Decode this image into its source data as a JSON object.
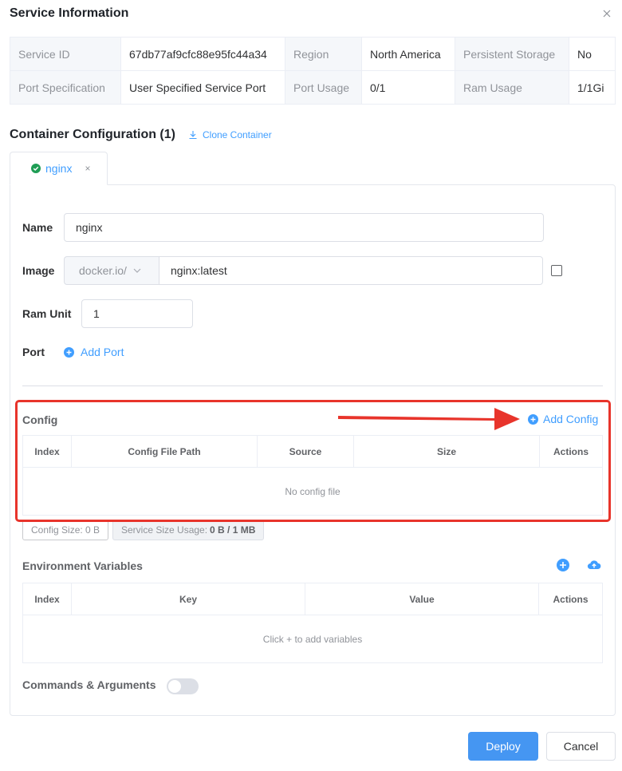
{
  "dialog": {
    "title": "Service Information"
  },
  "service_info": {
    "rows": [
      [
        {
          "label": "Service ID",
          "value": "67db77af9cfc88e95fc44a34"
        },
        {
          "label": "Region",
          "value": "North America"
        },
        {
          "label": "Persistent Storage",
          "value": "No"
        }
      ],
      [
        {
          "label": "Port Specification",
          "value": "User Specified Service Port"
        },
        {
          "label": "Port Usage",
          "value": "0/1"
        },
        {
          "label": "Ram Usage",
          "value": "1/1Gi"
        }
      ]
    ]
  },
  "container_section": {
    "title": "Container Configuration (1)",
    "clone_label": "Clone Container"
  },
  "tab": {
    "label": "nginx",
    "close": "×"
  },
  "form": {
    "name_label": "Name",
    "name_value": "nginx",
    "image_label": "Image",
    "image_prefix": "docker.io/",
    "image_value": "nginx:latest",
    "ram_label": "Ram Unit",
    "ram_value": "1",
    "port_label": "Port",
    "add_port_label": "Add Port"
  },
  "config": {
    "label": "Config",
    "add_label": "Add Config",
    "columns": [
      "Index",
      "Config File Path",
      "Source",
      "Size",
      "Actions"
    ],
    "empty_text": "No config file",
    "size_tag": "Config Size: 0 B",
    "usage_tag_label": "Service Size Usage: ",
    "usage_tag_value": "0 B / 1 MB"
  },
  "env": {
    "label": "Environment Variables",
    "columns": [
      "Index",
      "Key",
      "Value",
      "Actions"
    ],
    "empty_text": "Click + to add variables"
  },
  "commands": {
    "label": "Commands & Arguments",
    "enabled": false
  },
  "footer": {
    "deploy_label": "Deploy",
    "cancel_label": "Cancel"
  },
  "colors": {
    "accent": "#409eff",
    "primary_button": "#4596f2",
    "annotation": "#e8342b",
    "success": "#1f9d55"
  }
}
